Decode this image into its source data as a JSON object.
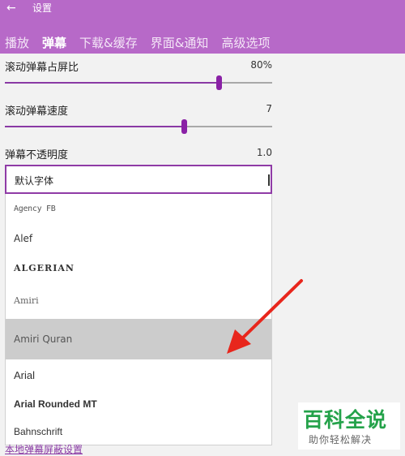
{
  "header": {
    "back_icon": "back-arrow-icon",
    "back_glyph": "←",
    "title": "设置",
    "color": "#b769c8",
    "tabs": [
      {
        "label": "播放",
        "active": false
      },
      {
        "label": "弹幕",
        "active": true
      },
      {
        "label": "下载&缓存",
        "active": false
      },
      {
        "label": "界面&通知",
        "active": false
      },
      {
        "label": "高级选项",
        "active": false
      }
    ]
  },
  "settings": {
    "screen_ratio": {
      "label": "滚动弹幕占屏比",
      "value": "80%",
      "fraction": 0.8
    },
    "speed": {
      "label": "滚动弹幕速度",
      "value": "7",
      "fraction": 0.67
    },
    "opacity": {
      "label": "弹幕不透明度",
      "value": "1.0"
    }
  },
  "font_dropdown": {
    "selected": "默认字体",
    "options": [
      {
        "label": "Agency FB",
        "selected": false
      },
      {
        "label": "Alef",
        "selected": false
      },
      {
        "label": "ALGERIAN",
        "selected": false
      },
      {
        "label": "Amiri",
        "selected": false
      },
      {
        "label": "Amiri Quran",
        "selected": true
      },
      {
        "label": "Arial",
        "selected": false
      },
      {
        "label": "Arial Rounded MT",
        "selected": false
      },
      {
        "label": "Bahnschrift",
        "selected": false
      }
    ]
  },
  "bottom_link": "本地弹幕屏蔽设置",
  "watermark": {
    "main": "百科全说",
    "sub": "助你轻松解决"
  },
  "accent_color": "#8a21a6"
}
